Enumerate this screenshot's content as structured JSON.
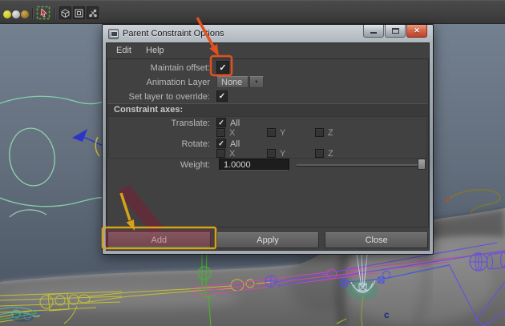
{
  "window": {
    "title": "Parent Constraint Options"
  },
  "menu": {
    "items": [
      "Edit",
      "Help"
    ]
  },
  "options": {
    "maintain_offset": {
      "label": "Maintain offset:",
      "checked": true
    },
    "animation_layer": {
      "label": "Animation Layer",
      "value": "None"
    },
    "set_layer_to_override": {
      "label": "Set layer to override:",
      "checked": true
    },
    "constraint_axes": {
      "header": "Constraint axes:",
      "translate_label": "Translate:",
      "rotate_label": "Rotate:",
      "all_label": "All",
      "axis_labels": [
        "X",
        "Y",
        "Z"
      ]
    },
    "weight": {
      "label": "Weight:",
      "value": "1.0000"
    }
  },
  "buttons": [
    "Add",
    "Apply",
    "Close"
  ],
  "icons": {
    "check": "✓",
    "dropdown_arrow": "▼",
    "close": "✕"
  },
  "viewport": {
    "annotation_letter": "c"
  },
  "colors": {
    "annotation_orange": "#e2501f",
    "annotation_yellow": "#d7a21a",
    "annotation_maroon": "#7a1f36",
    "dialog_bg": "#414141",
    "close_button_red": "#c54a2c",
    "viewport_top": "#717d8c",
    "viewport_bottom": "#4c5563"
  }
}
